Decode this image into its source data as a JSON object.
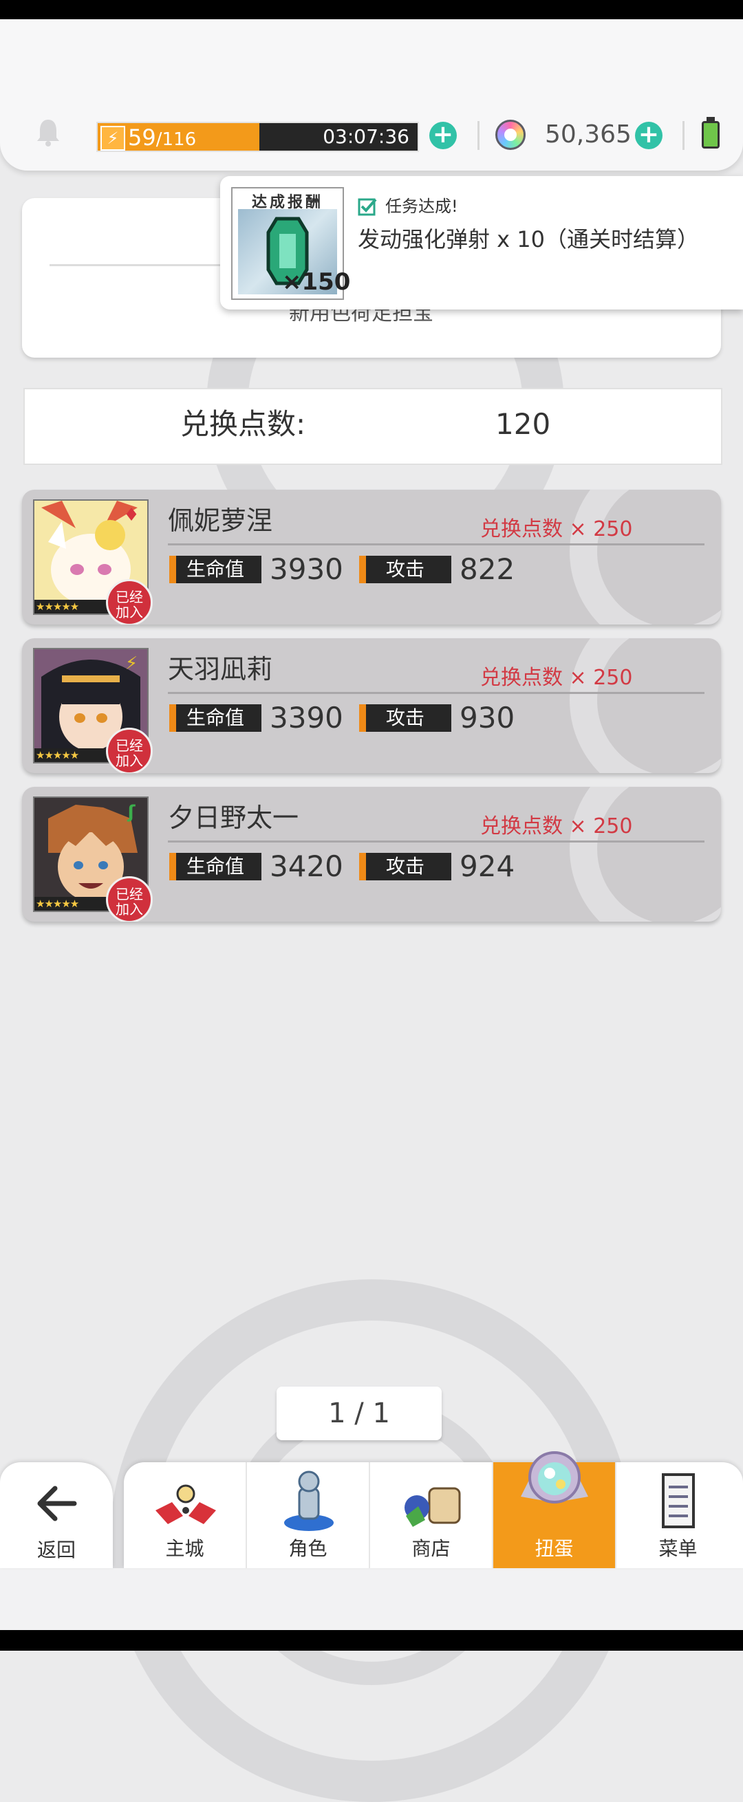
{
  "header": {
    "stamina_current": "59",
    "stamina_max": "/116",
    "stamina_fill_fraction": 0.51,
    "stamina_timer": "03:07:36",
    "gem_count": "50,365"
  },
  "toast": {
    "reward_title": "达成报酬",
    "reward_qty": "×150",
    "status": "任务达成!",
    "mission": "发动强化弹射 x 10（通关时结算）"
  },
  "banner": {
    "partial_text": "新用色荷足担宝"
  },
  "points": {
    "label": "兑换点数:",
    "value": "120"
  },
  "characters": [
    {
      "name": "佩妮萝涅",
      "cost": "兑换点数 × 250",
      "hp_label": "生命值",
      "hp": "3930",
      "atk_label": "攻击",
      "atk": "822",
      "joined": "已经加入",
      "stars": "★★★★★",
      "element": "fire"
    },
    {
      "name": "天羽凪莉",
      "cost": "兑换点数 × 250",
      "hp_label": "生命值",
      "hp": "3390",
      "atk_label": "攻击",
      "atk": "930",
      "joined": "已经加入",
      "stars": "★★★★★",
      "element": "thunder"
    },
    {
      "name": "夕日野太一",
      "cost": "兑换点数 × 250",
      "hp_label": "生命值",
      "hp": "3420",
      "atk_label": "攻击",
      "atk": "924",
      "joined": "已经加入",
      "stars": "★★★★★",
      "element": "wind"
    }
  ],
  "pager": "1 / 1",
  "nav": {
    "back": "返回",
    "tabs": [
      {
        "label": "主城",
        "icon": "town-icon"
      },
      {
        "label": "角色",
        "icon": "character-icon"
      },
      {
        "label": "商店",
        "icon": "shop-icon"
      },
      {
        "label": "扭蛋",
        "icon": "gacha-icon",
        "active": true
      },
      {
        "label": "菜单",
        "icon": "menu-icon"
      }
    ]
  },
  "colors": {
    "accent_orange": "#f39a1a",
    "plus_teal": "#31c2a7",
    "cost_red": "#d23a44",
    "joined_red": "#d0303c"
  }
}
